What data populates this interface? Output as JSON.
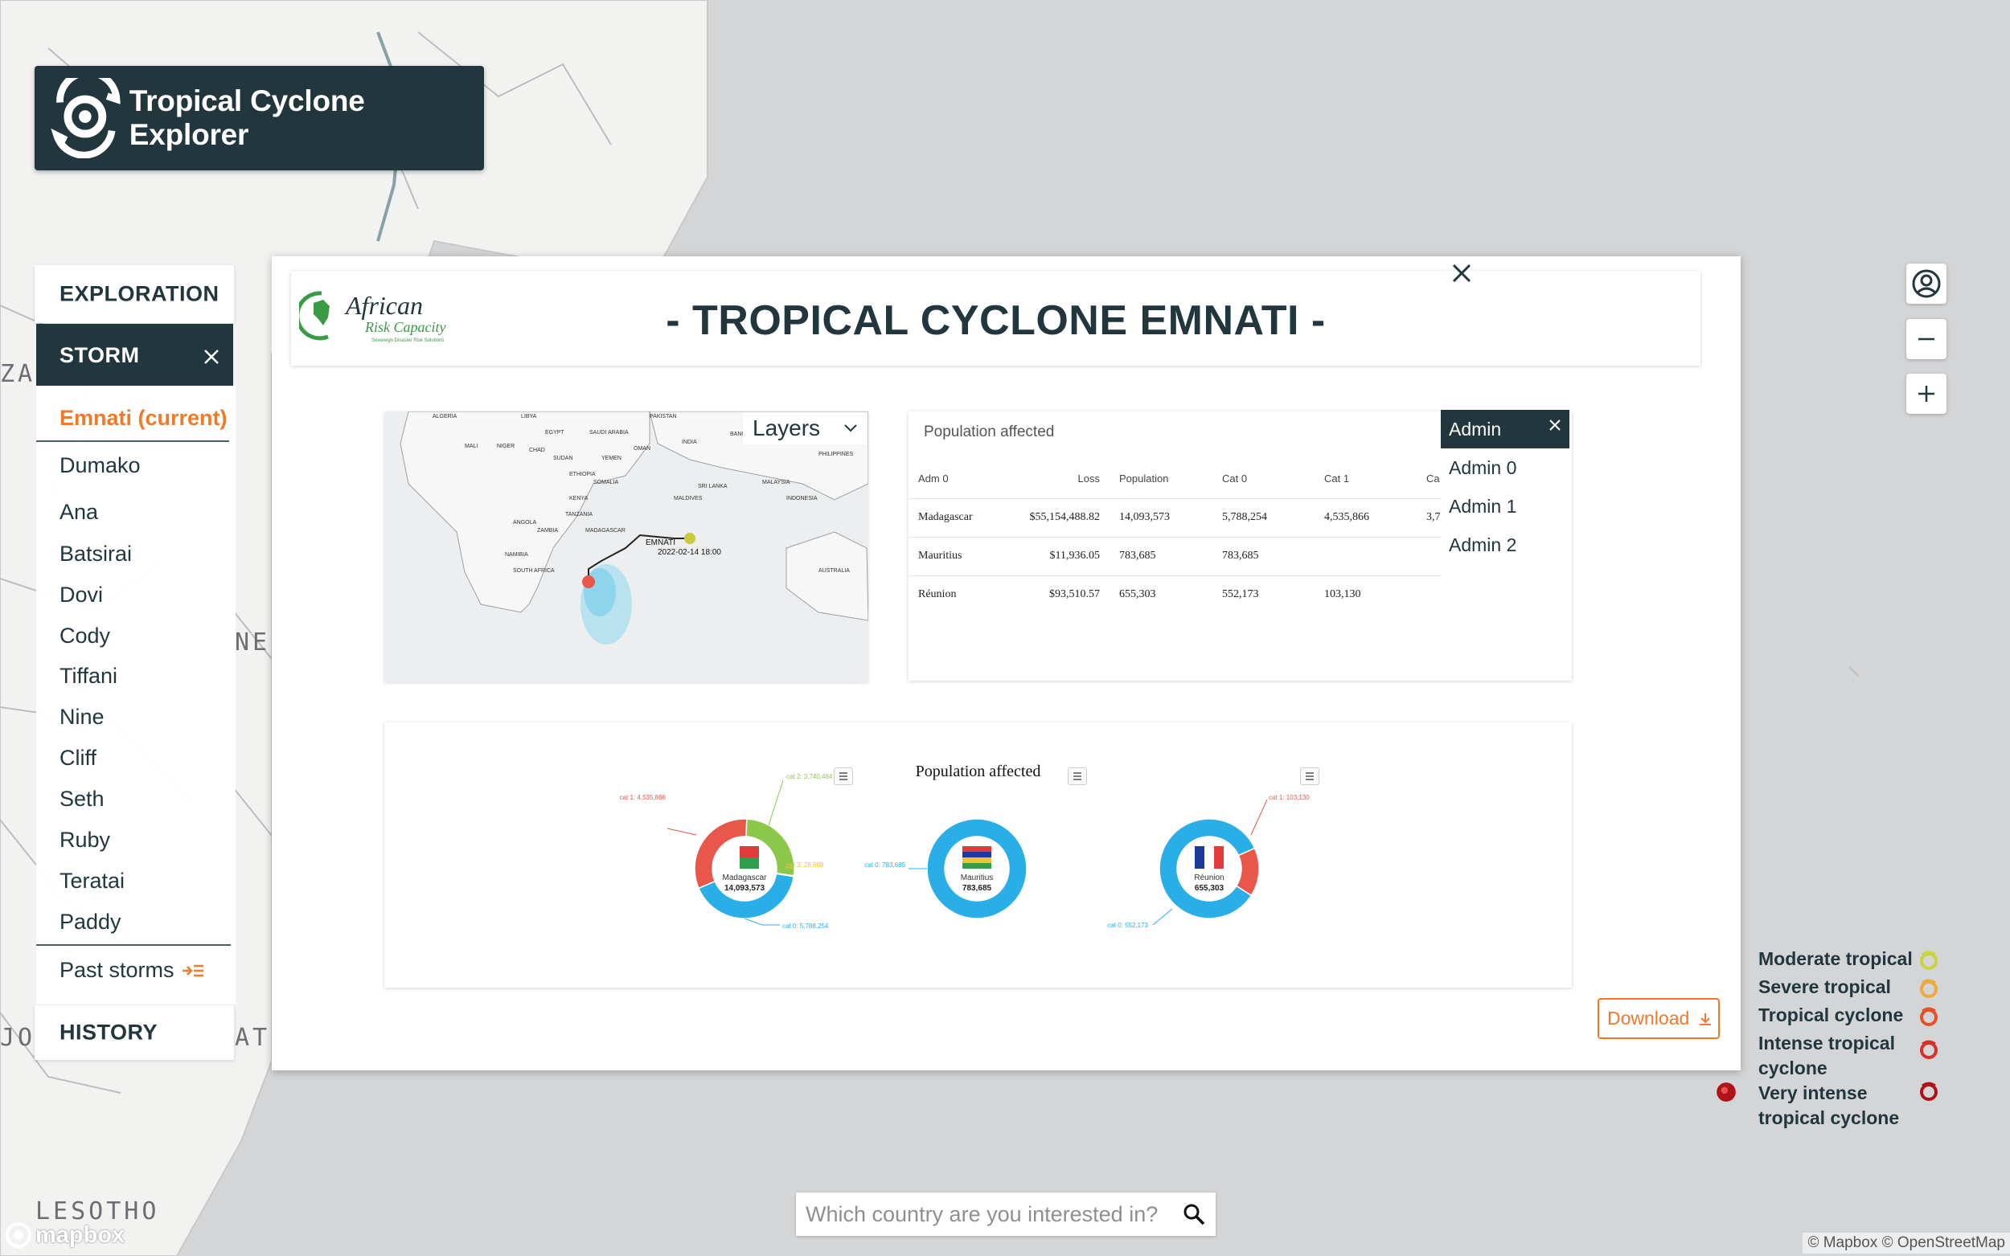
{
  "app": {
    "title": "Tropical Cyclone Explorer"
  },
  "nav": {
    "exploration": "EXPLORATION",
    "storm": "STORM",
    "history": "HISTORY",
    "storms": [
      "Emnati (current)",
      "Dumako",
      "Ana",
      "Batsirai",
      "Dovi",
      "Cody",
      "Tiffani",
      "Nine",
      "Cliff",
      "Seth",
      "Ruby",
      "Teratai",
      "Paddy"
    ],
    "past_storms": "Past storms"
  },
  "map_labels": [
    "ZA",
    "NE",
    "JO",
    "AT",
    "LESOTHO"
  ],
  "legend": [
    {
      "label": "Moderate tropical",
      "color": "#c8d43a"
    },
    {
      "label": "Severe tropical",
      "color": "#f0a93a"
    },
    {
      "label": "Tropical cyclone",
      "color": "#e8502a"
    },
    {
      "label": "Intense tropical cyclone",
      "color": "#d8302a"
    },
    {
      "label": "Very intense tropical cyclone",
      "color": "#b0121a"
    }
  ],
  "search": {
    "placeholder": "Which country are you interested in?"
  },
  "attribution": "© Mapbox © OpenStreetMap",
  "mapbox_logo": "mapbox",
  "modal": {
    "title": "- TROPICAL CYCLONE EMNATI -",
    "org_logo_text": "African",
    "org_logo_text2": "Risk Capacity",
    "org_logo_tag": "Sovereign Disaster Risk Solutions",
    "layers_label": "Layers",
    "minimap": {
      "track_label": "EMNATI",
      "track_time": "2022-02-14 18:00",
      "countries": [
        "ALGERIA",
        "LIBYA",
        "EGYPT",
        "SAUDI ARABIA",
        "PAKISTAN",
        "INDIA",
        "OMAN",
        "YEMEN",
        "MALI",
        "NIGER",
        "CHAD",
        "SUDAN",
        "ETHIOPIA",
        "SOMALIA",
        "KENYA",
        "TANZANIA",
        "ANGOLA",
        "ZAMBIA",
        "NAMIBIA",
        "SOUTH AFRICA",
        "MADAGASCAR",
        "SRI LANKA",
        "MALDIVES",
        "MALAYSIA",
        "INDONESIA",
        "AUSTRALIA",
        "BANGLADESH",
        "PHILIPPINES"
      ]
    },
    "table": {
      "title": "Population affected",
      "columns": [
        "Adm 0",
        "Loss",
        "Population",
        "Cat 0",
        "Cat 1",
        "Ca"
      ],
      "rows": [
        [
          "Madagascar",
          "$55,154,488.82",
          "14,093,573",
          "5,788,254",
          "4,535,866",
          "3,7"
        ],
        [
          "Mauritius",
          "$11,936.05",
          "783,685",
          "783,685",
          "",
          ""
        ],
        [
          "Réunion",
          "$93,510.57",
          "655,303",
          "552,173",
          "103,130",
          ""
        ]
      ]
    },
    "admin": {
      "title": "Admin",
      "items": [
        "Admin 0",
        "Admin 1",
        "Admin 2"
      ]
    },
    "donut_title": "Population affected",
    "donuts": [
      {
        "country": "Madagascar",
        "total": "14,093,573",
        "labels": [
          "cat 1: 4,535,866",
          "cat 2: 3,740,484",
          "cat 3: 28,968",
          "cat 0: 5,788,254"
        ],
        "values": [
          5788254,
          4535866,
          3740484,
          28968
        ]
      },
      {
        "country": "Mauritius",
        "total": "783,685",
        "labels": [
          "cat 0: 783,685"
        ],
        "values": [
          783685
        ]
      },
      {
        "country": "Réunion",
        "total": "655,303",
        "labels": [
          "cat 1: 103,130",
          "cat 0: 552,173"
        ],
        "values": [
          552173,
          103130
        ]
      }
    ],
    "download": "Download"
  }
}
